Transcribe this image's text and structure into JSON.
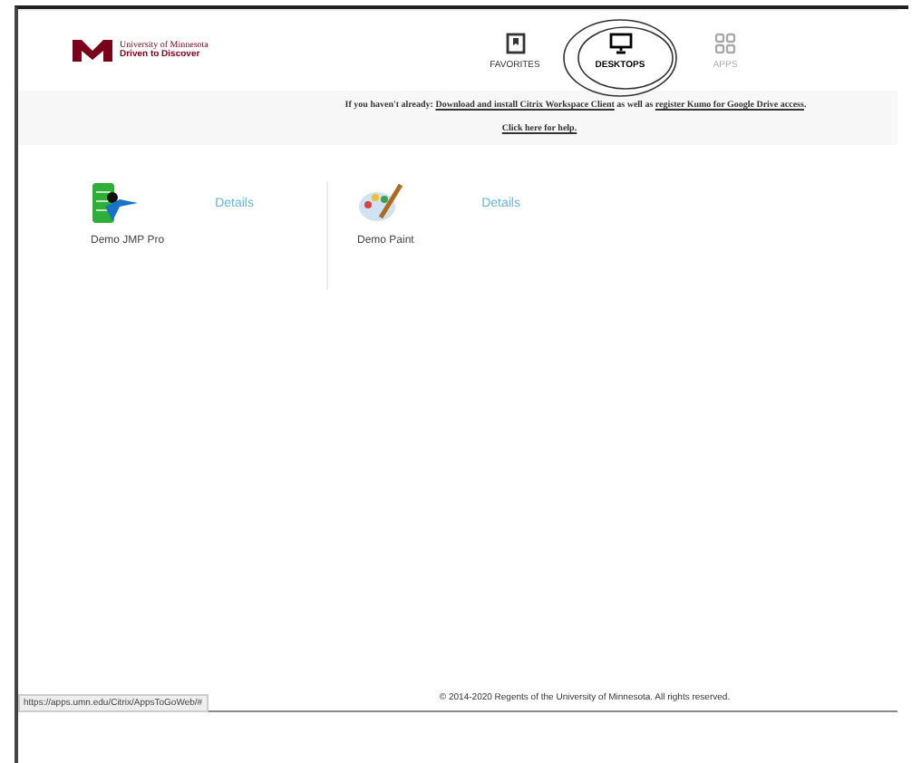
{
  "header": {
    "logo_top": "University of Minnesota",
    "logo_bottom": "Driven to Discover",
    "tabs": [
      {
        "label": "FAVORITES",
        "kind": "bookmark",
        "selected": false,
        "disabled": false
      },
      {
        "label": "DESKTOPS",
        "kind": "monitor",
        "selected": true,
        "disabled": false
      },
      {
        "label": "APPS",
        "kind": "grid",
        "selected": false,
        "disabled": true
      }
    ]
  },
  "notice": {
    "prefix": "If you haven't already:",
    "link1": "Download and install Citrix Workspace Client",
    "middle": "as well as",
    "link2": "register Kumo for Google Drive access",
    "suffix": ".",
    "help": "Click here for help."
  },
  "apps": [
    {
      "name": "Demo JMP Pro",
      "kind": "jmp",
      "action": "Details"
    },
    {
      "name": "Demo Paint",
      "kind": "paint",
      "action": "Details"
    }
  ],
  "footer": "© 2014-2020 Regents of the University of Minnesota. All rights reserved.",
  "status_url": "https://apps.umn.edu/Citrix/AppsToGoWeb/#"
}
